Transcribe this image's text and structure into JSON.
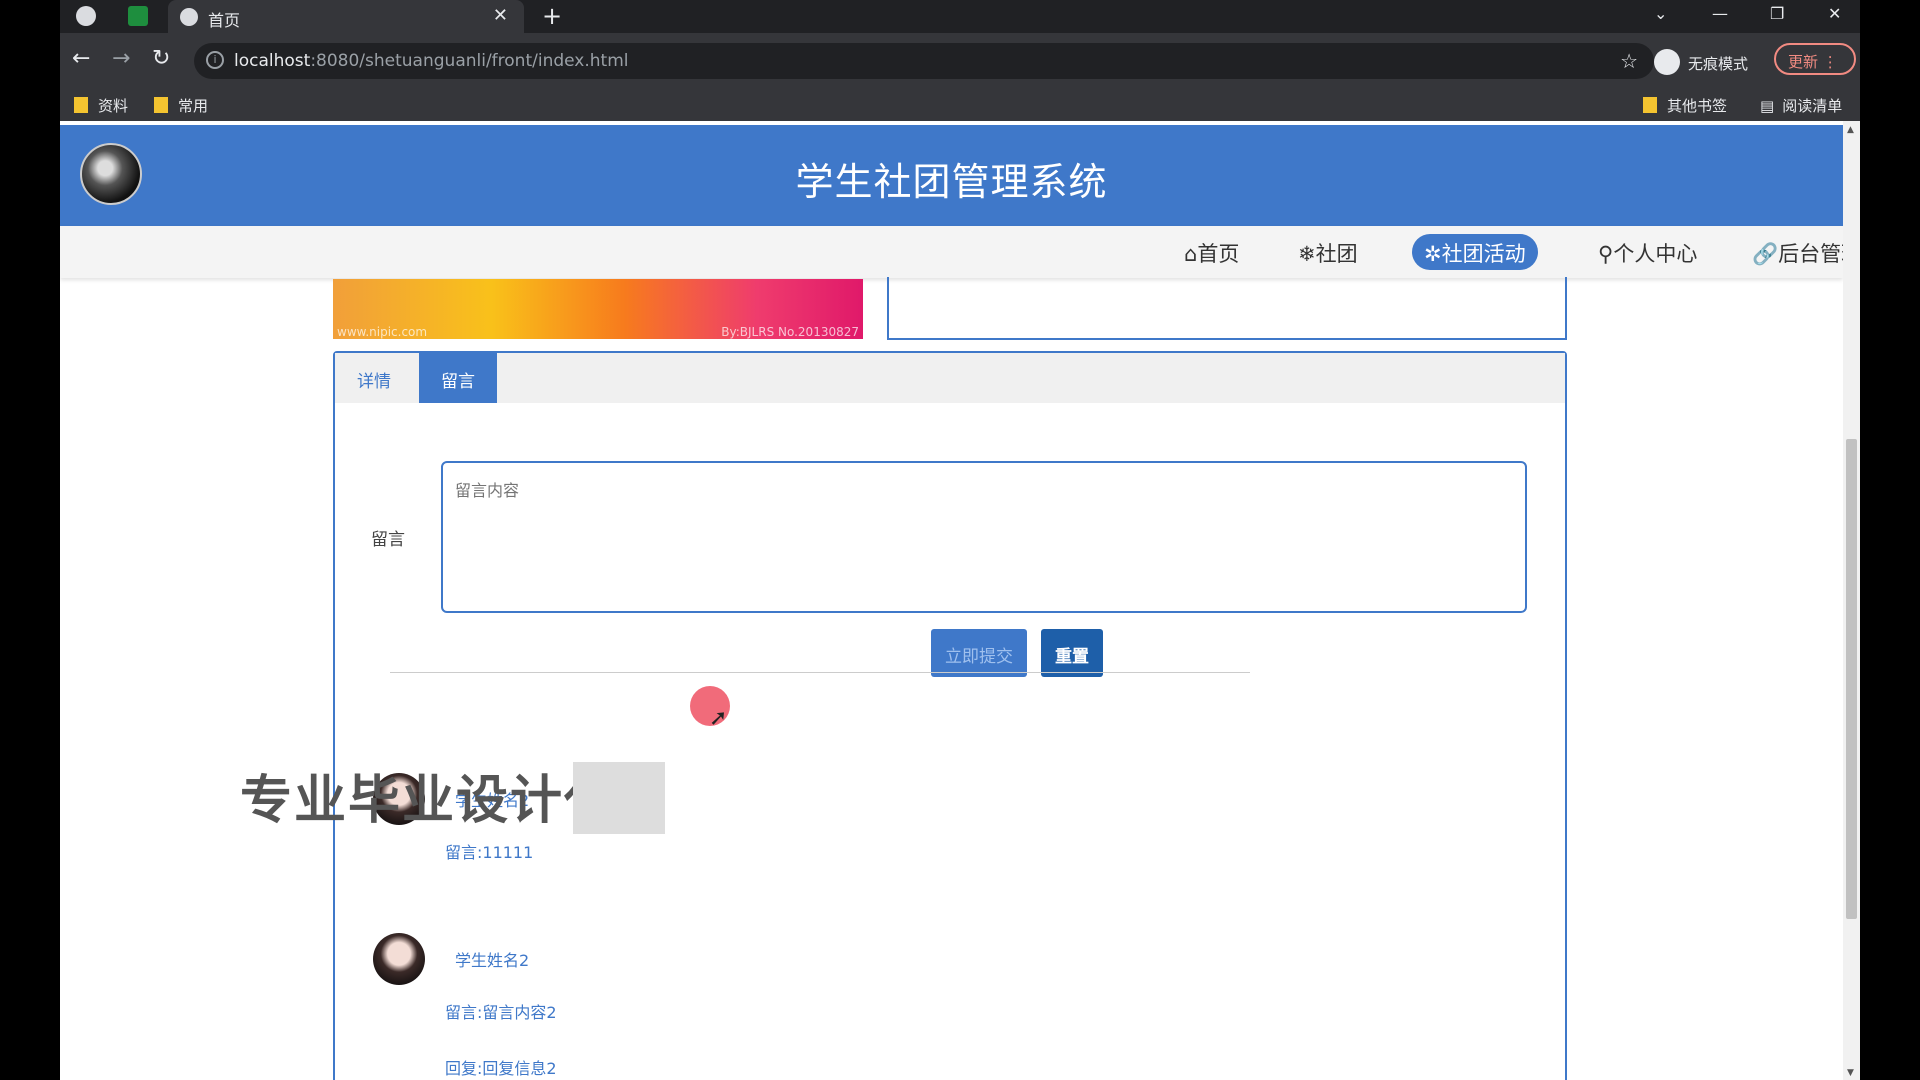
{
  "browser": {
    "tab_title": "首页",
    "tab_close": "✕",
    "new_tab": "+",
    "url_host": "localhost",
    "url_rest": ":8080/shetuanguanli/front/index.html",
    "profile_label": "无痕模式",
    "update_label": "更新",
    "bookmarks": [
      "资料",
      "常用"
    ],
    "bookmarks_right": [
      "其他书签",
      "阅读清单"
    ],
    "window_controls": [
      "⌄",
      "—",
      "❐",
      "✕"
    ]
  },
  "site": {
    "title": "学生社团管理系统",
    "nav": [
      {
        "icon": "⌂",
        "label": "首页"
      },
      {
        "icon": "❄",
        "label": "社团"
      },
      {
        "icon": "✲",
        "label": "社团活动",
        "active": true
      },
      {
        "icon": "⚲",
        "label": "个人中心"
      },
      {
        "icon": "🔗",
        "label": "后台管理"
      }
    ]
  },
  "banner": {
    "watermark_left": "www.nipic.com",
    "watermark_right": "By:BJLRS No.20130827"
  },
  "tabs": {
    "detail": "详情",
    "message": "留言"
  },
  "form": {
    "label": "留言",
    "placeholder": "留言内容",
    "submit": "立即提交",
    "reset": "重置"
  },
  "messages": [
    {
      "name": "学生姓名2",
      "text": "留言:11111"
    },
    {
      "name": "学生姓名2",
      "text": "留言:留言内容2",
      "reply": "回复:回复信息2"
    }
  ],
  "overlay": {
    "text": "专业毕业设计代"
  }
}
